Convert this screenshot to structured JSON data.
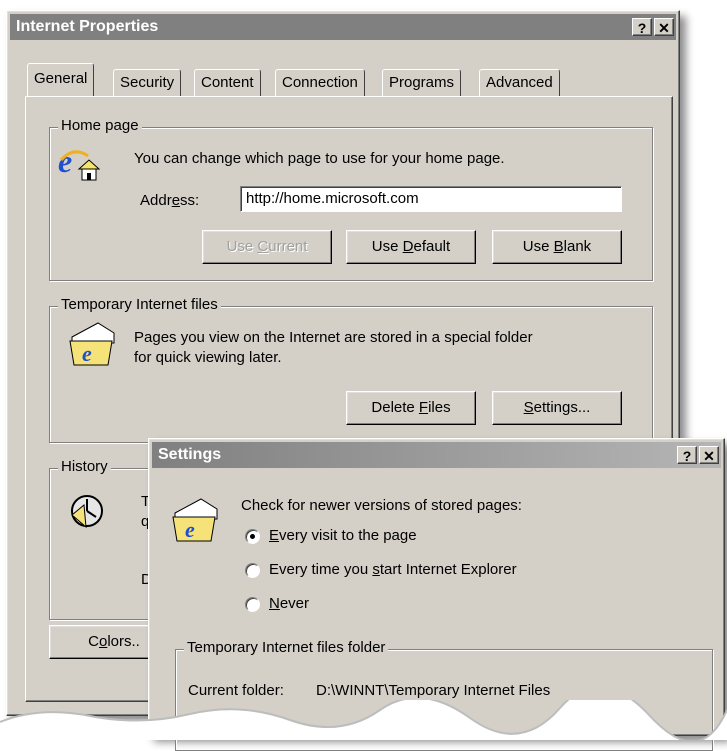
{
  "main_window": {
    "title": "Internet Properties",
    "help_btn": "?",
    "close_btn": "✕",
    "tabs": [
      {
        "label": "General",
        "active": true
      },
      {
        "label": "Security"
      },
      {
        "label": "Content"
      },
      {
        "label": "Connection"
      },
      {
        "label": "Programs"
      },
      {
        "label": "Advanced"
      }
    ],
    "home_page": {
      "label": "Home page",
      "description": "You can change which page to use for your home page.",
      "address_label_pre": "Addr",
      "address_label_u": "e",
      "address_label_post": "ss:",
      "address_value": "http://home.microsoft.com",
      "use_current_pre": "Use ",
      "use_current_u": "C",
      "use_current_post": "urrent",
      "use_default_pre": "Use ",
      "use_default_u": "D",
      "use_default_post": "efault",
      "use_blank_pre": "Use ",
      "use_blank_u": "B",
      "use_blank_post": "lank"
    },
    "temp_files": {
      "label": "Temporary Internet files",
      "description_line1": "Pages you view on the Internet are stored in a special folder",
      "description_line2": "for quick viewing later.",
      "delete_pre": "Delete ",
      "delete_u": "F",
      "delete_post": "iles",
      "settings_u": "S",
      "settings_post": "ettings..."
    },
    "history": {
      "label": "History",
      "frag1": "T",
      "frag2": "q",
      "frag3": "D"
    },
    "colors_pre": "C",
    "colors_u": "o",
    "colors_post": "lors.."
  },
  "settings_dialog": {
    "title": "Settings",
    "help_btn": "?",
    "close_btn": "✕",
    "check_label": "Check for newer versions of stored pages:",
    "options": [
      {
        "pre": "",
        "u": "E",
        "post": "very visit to the page",
        "checked": true
      },
      {
        "pre": "Every time you ",
        "u": "s",
        "post": "tart Internet Explorer",
        "checked": false
      },
      {
        "pre": "",
        "u": "N",
        "post": "ever",
        "checked": false
      }
    ],
    "folder_group_label": "Temporary Internet files folder",
    "current_folder_label": "Current folder:",
    "current_folder_value": "D:\\WINNT\\Temporary Internet Files"
  }
}
